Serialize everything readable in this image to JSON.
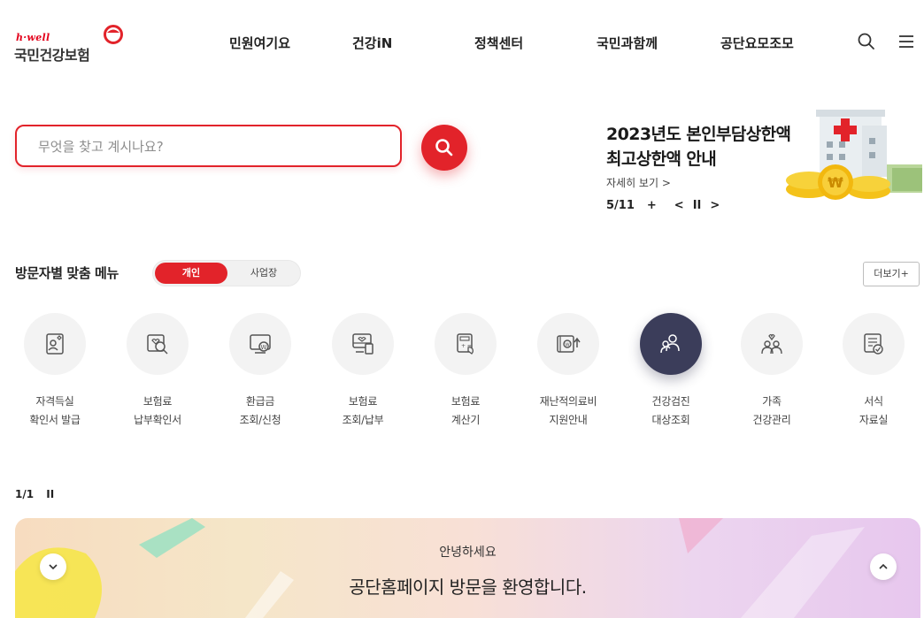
{
  "brand": {
    "tagline": "h·well",
    "name": "국민건강보험",
    "accent_color": "#e2232a"
  },
  "nav": {
    "items": [
      {
        "label": "민원여기요"
      },
      {
        "label": "건강iN"
      },
      {
        "label": "정책센터"
      },
      {
        "label": "국민과함께"
      },
      {
        "label": "공단요모조모"
      }
    ],
    "search_icon": "search-icon",
    "menu_icon": "hamburger-icon"
  },
  "search": {
    "placeholder": "무엇을 찾고 계시나요?",
    "button_icon": "search-icon"
  },
  "banner": {
    "title_line1": "2023년도 본인부담상한액",
    "title_line2": "최고상한액 안내",
    "link": "자세히 보기 >",
    "page": "5/11",
    "add": "+",
    "prev": "<",
    "pause": "II",
    "next": ">"
  },
  "visitor_menu": {
    "title": "방문자별 맞춤 메뉴",
    "toggle": {
      "selected": "개인",
      "other": "사업장"
    },
    "more": "더보기+",
    "items": [
      {
        "line1": "자격득실",
        "line2": "확인서 발급",
        "icon": "id-card-icon"
      },
      {
        "line1": "보험료",
        "line2": "납부확인서",
        "icon": "receipt-search-icon"
      },
      {
        "line1": "환급금",
        "line2": "조회/신청",
        "icon": "refund-monitor-icon"
      },
      {
        "line1": "보험료",
        "line2": "조회/납부",
        "icon": "payment-monitor-icon"
      },
      {
        "line1": "보험료",
        "line2": "계산기",
        "icon": "calculator-icon"
      },
      {
        "line1": "재난적의료비",
        "line2": "지원안내",
        "icon": "medical-support-icon"
      },
      {
        "line1": "건강검진",
        "line2": "대상조회",
        "icon": "people-search-icon",
        "active": true
      },
      {
        "line1": "가족",
        "line2": "건강관리",
        "icon": "family-care-icon"
      },
      {
        "line1": "서식",
        "line2": "자료실",
        "icon": "document-check-icon"
      }
    ],
    "pager": "1/1",
    "pager_pause": "II"
  },
  "welcome": {
    "hello": "안녕하세요",
    "message": "공단홈페이지 방문을 환영합니다."
  }
}
